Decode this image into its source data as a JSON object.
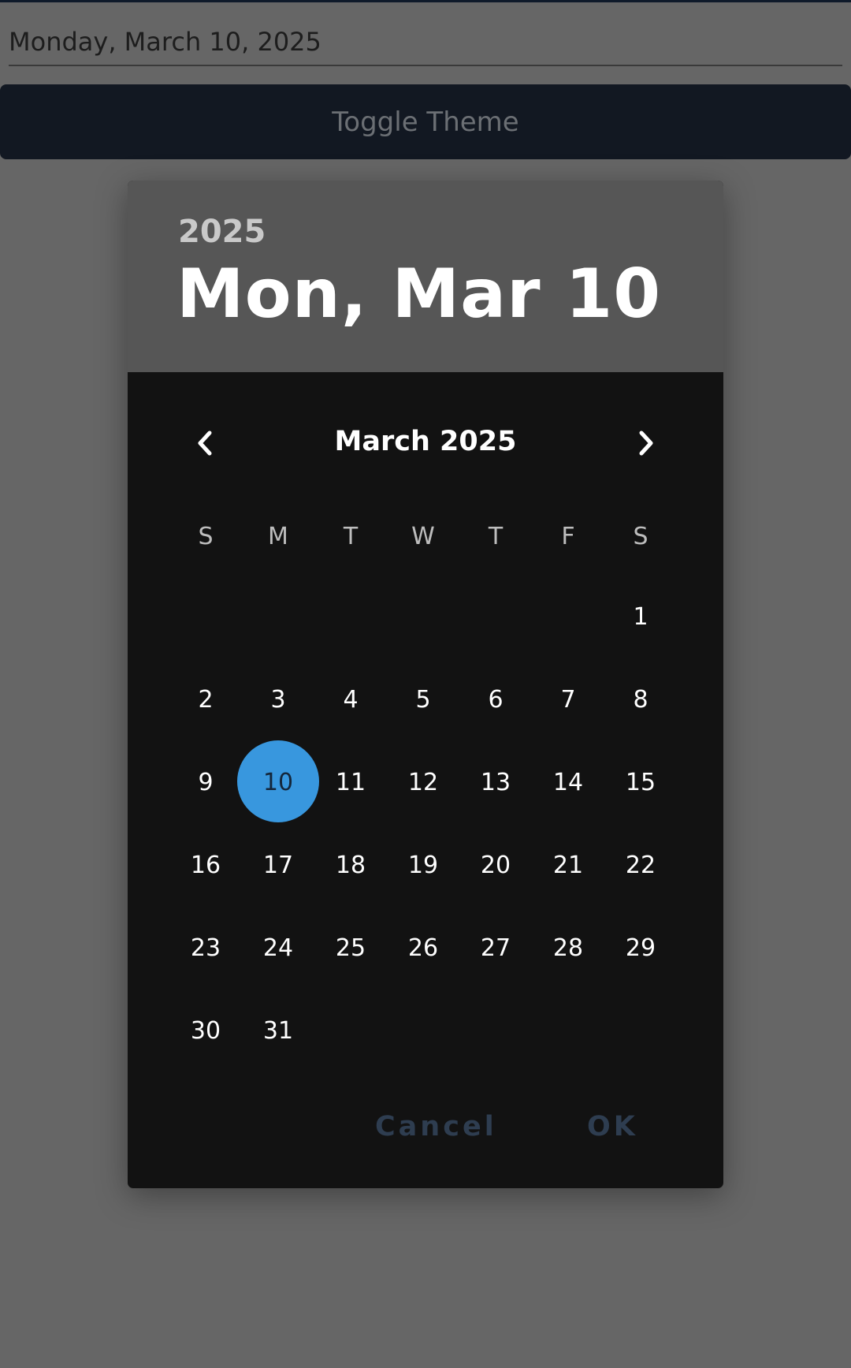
{
  "date_field": {
    "value": "Monday, March 10, 2025"
  },
  "toggle_button": {
    "label": "Toggle Theme"
  },
  "dialog": {
    "header_year": "2025",
    "header_date": "Mon, Mar 10",
    "month_label": "March 2025",
    "weekdays": [
      "S",
      "M",
      "T",
      "W",
      "T",
      "F",
      "S"
    ],
    "days": [
      "1",
      "2",
      "3",
      "4",
      "5",
      "6",
      "7",
      "8",
      "9",
      "10",
      "11",
      "12",
      "13",
      "14",
      "15",
      "16",
      "17",
      "18",
      "19",
      "20",
      "21",
      "22",
      "23",
      "24",
      "25",
      "26",
      "27",
      "28",
      "29",
      "30",
      "31"
    ],
    "selected_day": "10",
    "cancel_label": "Cancel",
    "ok_label": "OK"
  },
  "colors": {
    "selected_circle": "#3897de",
    "header_bg": "#565656",
    "dialog_bg": "#121212",
    "toggle_bg": "#121822",
    "action_text": "#2e3d50"
  },
  "icons": {
    "prev": "chevron-left-icon",
    "next": "chevron-right-icon"
  }
}
